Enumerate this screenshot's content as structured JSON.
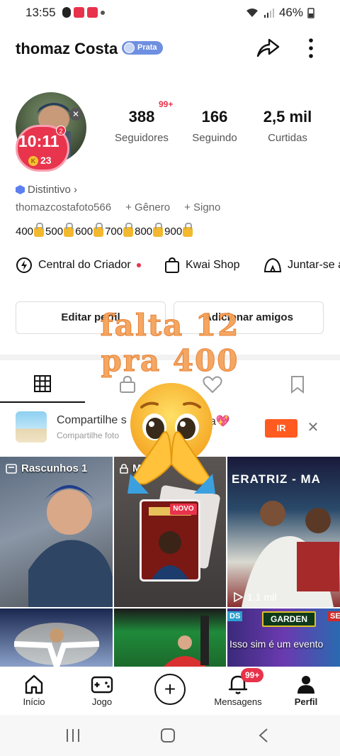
{
  "status_bar": {
    "time": "13:55",
    "battery": "46%"
  },
  "header": {
    "username": "thomaz Costa",
    "level_badge": "Prata"
  },
  "profile": {
    "avatar_clock": "10:11",
    "avatar_coins": "23",
    "avatar_coin_symbol": "K",
    "avatar_notif": "2",
    "stats_badge": "99+",
    "stats": [
      {
        "value": "388",
        "label": "Seguidores"
      },
      {
        "value": "166",
        "label": "Seguindo"
      },
      {
        "value": "2,5 mil",
        "label": "Curtidas"
      }
    ],
    "distintivo": "Distintivo ›",
    "handle": "thomazcostafoto566",
    "gender": "+ Gênero",
    "sign": "+ Signo",
    "locks": [
      "400",
      "500",
      "600",
      "700",
      "800",
      "900"
    ]
  },
  "shortcuts": [
    {
      "label": "Central do Criador"
    },
    {
      "label": "Kwai Shop"
    },
    {
      "label": "Juntar-se a"
    }
  ],
  "buttons": {
    "edit": "Editar perfil",
    "add": "Adicionar amigos"
  },
  "overlay": {
    "line1": "falta 12",
    "line2": "pra 400"
  },
  "promo": {
    "title": "Compartilhe s",
    "title_end": "a💖",
    "subtitle": "Compartilhe foto",
    "cta": "IR"
  },
  "grid": {
    "drafts": "Rascunhos 1",
    "private_label": "M",
    "new_badge": "NOVO",
    "views": "1,1 mil",
    "banner": "ERATRIZ - MA",
    "garden": "GARDEN",
    "caption": "Isso sim é um evento"
  },
  "nav": {
    "items": [
      {
        "label": "Início"
      },
      {
        "label": "Jogo"
      },
      {
        "label": "Mensagens"
      },
      {
        "label": "Perfil"
      }
    ],
    "messages_badge": "99+"
  },
  "colors": {
    "accent": "#e8324b",
    "cta": "#ff5a1f",
    "overlay": "#f5a35a",
    "badge_blue": "#6f8fe0"
  }
}
